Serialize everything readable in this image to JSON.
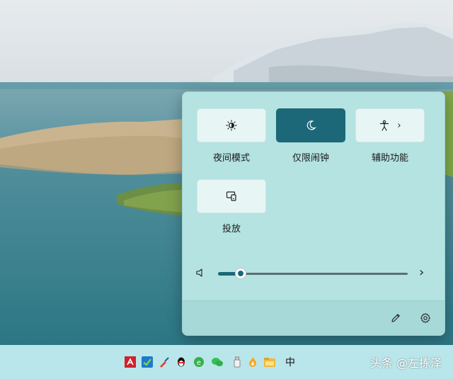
{
  "quick_settings": {
    "tiles": [
      {
        "label": "夜间模式",
        "icon": "night-light-icon",
        "active": false
      },
      {
        "label": "仅限闹钟",
        "icon": "moon-icon",
        "active": true
      },
      {
        "label": "辅助功能",
        "icon": "accessibility-icon",
        "active": false,
        "has_chevron": true,
        "chevron": "›"
      },
      {
        "label": "投放",
        "icon": "cast-icon",
        "active": false
      }
    ],
    "volume": {
      "icon": "speaker-icon",
      "level": 0.12,
      "more_icon": "chevron-right-icon",
      "more_glyph": "›"
    },
    "footer": {
      "edit_icon": "pencil-icon",
      "settings_icon": "gear-icon"
    }
  },
  "taskbar": {
    "icons": [
      "amd-icon",
      "app-green-icon",
      "brush-icon",
      "qq-penguin-icon",
      "browser-e-icon",
      "wechat-icon",
      "usb-drive-icon",
      "flame-icon",
      "folder-icon"
    ],
    "ime_label": "中"
  },
  "watermark": "头条 @左拣泽",
  "colors": {
    "accent": "#1c6878",
    "panel": "#b4e3e1",
    "taskbar": "#b9e6ea"
  }
}
